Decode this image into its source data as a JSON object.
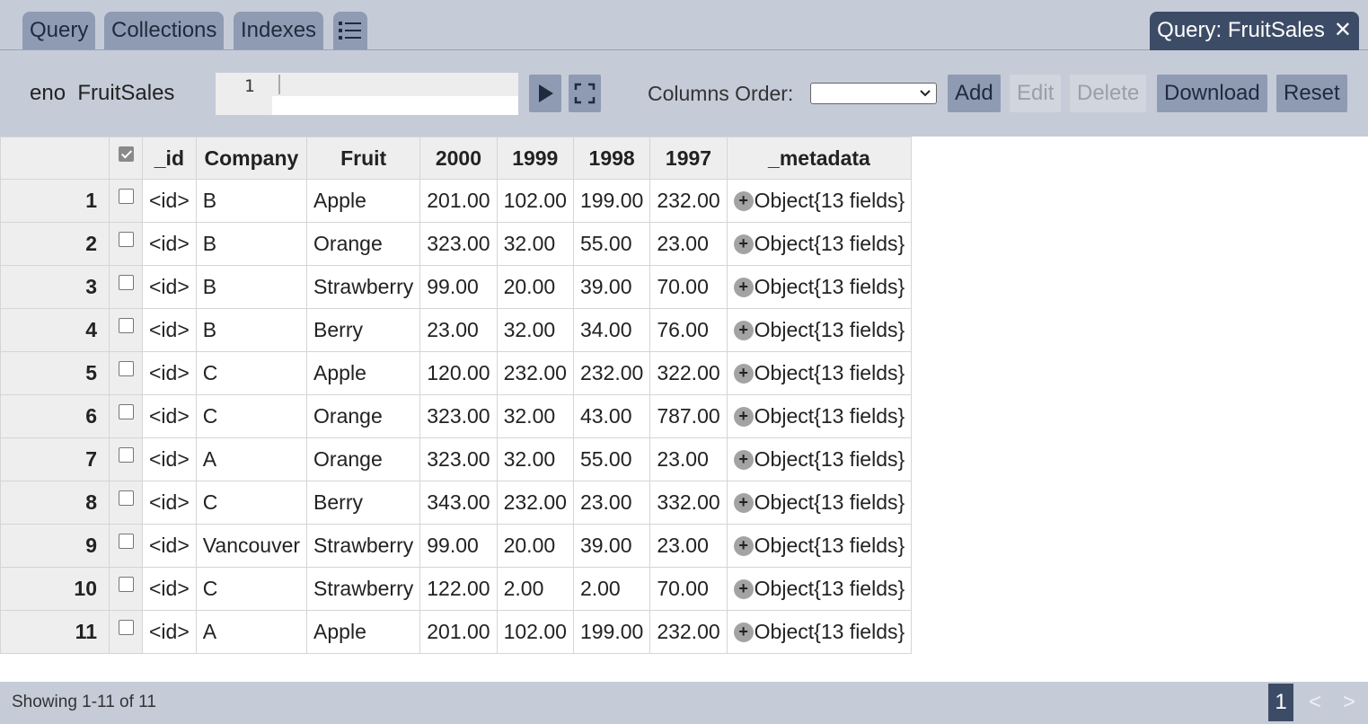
{
  "tabs": {
    "items": [
      {
        "label": "Query"
      },
      {
        "label": "Collections"
      },
      {
        "label": "Indexes"
      }
    ],
    "list_icon": "list-icon",
    "active": {
      "label": "Query: FruitSales",
      "close": "✕"
    }
  },
  "toolbar": {
    "database": "eno",
    "collection": "FruitSales",
    "editor_line_number": "1",
    "run_icon": "play-icon",
    "expand_icon": "fullscreen-icon",
    "columns_order_label": "Columns Order:",
    "columns_order_value": "",
    "buttons": {
      "add": "Add",
      "edit": "Edit",
      "delete": "Delete",
      "download": "Download",
      "reset": "Reset"
    }
  },
  "table": {
    "headers": [
      "_id",
      "Company",
      "Fruit",
      "2000",
      "1999",
      "1998",
      "1997",
      "_metadata"
    ],
    "rows": [
      {
        "n": "1",
        "id": "<id>",
        "company": "B",
        "fruit": "Apple",
        "y2000": "201.00",
        "y1999": "102.00",
        "y1998": "199.00",
        "y1997": "232.00",
        "meta": "Object{13 fields}"
      },
      {
        "n": "2",
        "id": "<id>",
        "company": "B",
        "fruit": "Orange",
        "y2000": "323.00",
        "y1999": "32.00",
        "y1998": "55.00",
        "y1997": "23.00",
        "meta": "Object{13 fields}"
      },
      {
        "n": "3",
        "id": "<id>",
        "company": "B",
        "fruit": "Strawberry",
        "y2000": "99.00",
        "y1999": "20.00",
        "y1998": "39.00",
        "y1997": "70.00",
        "meta": "Object{13 fields}"
      },
      {
        "n": "4",
        "id": "<id>",
        "company": "B",
        "fruit": "Berry",
        "y2000": "23.00",
        "y1999": "32.00",
        "y1998": "34.00",
        "y1997": "76.00",
        "meta": "Object{13 fields}"
      },
      {
        "n": "5",
        "id": "<id>",
        "company": "C",
        "fruit": "Apple",
        "y2000": "120.00",
        "y1999": "232.00",
        "y1998": "232.00",
        "y1997": "322.00",
        "meta": "Object{13 fields}"
      },
      {
        "n": "6",
        "id": "<id>",
        "company": "C",
        "fruit": "Orange",
        "y2000": "323.00",
        "y1999": "32.00",
        "y1998": "43.00",
        "y1997": "787.00",
        "meta": "Object{13 fields}"
      },
      {
        "n": "7",
        "id": "<id>",
        "company": "A",
        "fruit": "Orange",
        "y2000": "323.00",
        "y1999": "32.00",
        "y1998": "55.00",
        "y1997": "23.00",
        "meta": "Object{13 fields}"
      },
      {
        "n": "8",
        "id": "<id>",
        "company": "C",
        "fruit": "Berry",
        "y2000": "343.00",
        "y1999": "232.00",
        "y1998": "23.00",
        "y1997": "332.00",
        "meta": "Object{13 fields}"
      },
      {
        "n": "9",
        "id": "<id>",
        "company": "Vancouver",
        "fruit": "Strawberry",
        "y2000": "99.00",
        "y1999": "20.00",
        "y1998": "39.00",
        "y1997": "23.00",
        "meta": "Object{13 fields}"
      },
      {
        "n": "10",
        "id": "<id>",
        "company": "C",
        "fruit": "Strawberry",
        "y2000": "122.00",
        "y1999": "2.00",
        "y1998": "2.00",
        "y1997": "70.00",
        "meta": "Object{13 fields}"
      },
      {
        "n": "11",
        "id": "<id>",
        "company": "A",
        "fruit": "Apple",
        "y2000": "201.00",
        "y1999": "102.00",
        "y1998": "199.00",
        "y1997": "232.00",
        "meta": "Object{13 fields}"
      }
    ],
    "expand_symbol": "+"
  },
  "footer": {
    "status": "Showing 1-11 of 11",
    "current_page": "1",
    "prev": "<",
    "next": ">"
  },
  "colors": {
    "chrome": "#c5ccd8",
    "button": "#8f9bb3",
    "active_tab": "#3d4c66"
  }
}
